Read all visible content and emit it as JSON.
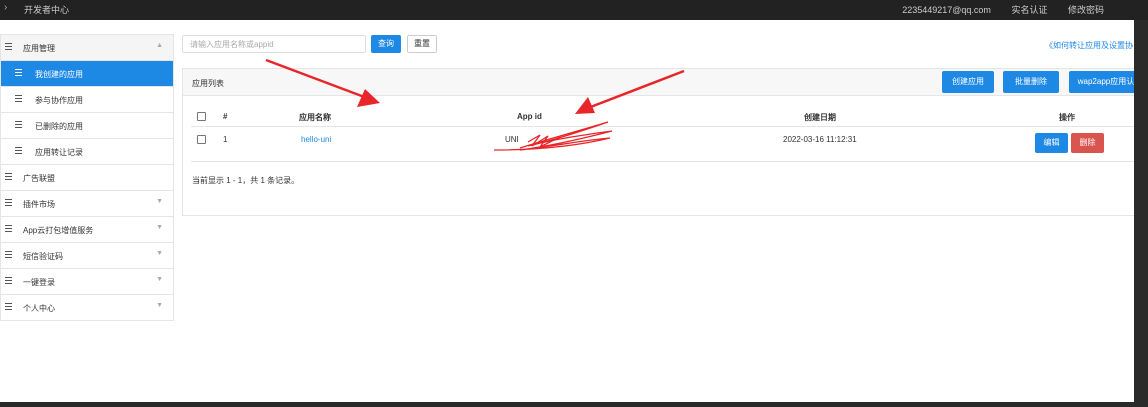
{
  "topbar": {
    "title": "开发者中心",
    "email": "2235449217@qq.com",
    "verify": "实名认证",
    "change_password": "修改密码"
  },
  "sidebar": {
    "items": [
      {
        "label": "应用管理",
        "type": "group-open"
      },
      {
        "label": "我创建的应用",
        "type": "sub-active"
      },
      {
        "label": "参与协作应用",
        "type": "sub"
      },
      {
        "label": "已删除的应用",
        "type": "sub"
      },
      {
        "label": "应用转让记录",
        "type": "sub"
      },
      {
        "label": "广告联盟",
        "type": "group"
      },
      {
        "label": "插件市场",
        "type": "group-caret"
      },
      {
        "label": "App云打包增值服务",
        "type": "group-caret"
      },
      {
        "label": "短信验证码",
        "type": "group-caret"
      },
      {
        "label": "一键登录",
        "type": "group-caret"
      },
      {
        "label": "个人中心",
        "type": "group-caret"
      }
    ]
  },
  "search": {
    "placeholder": "请输入应用名称或appid",
    "query_label": "查询",
    "reset_label": "重置"
  },
  "help_link": "《如何转让应用及设置协",
  "panel": {
    "title": "应用列表",
    "create_label": "创建应用",
    "batch_delete_label": "批量删除",
    "wap2app_label": "wap2app应用认"
  },
  "table": {
    "headers": {
      "index": "#",
      "name": "应用名称",
      "appid": "App id",
      "created": "创建日期",
      "ops": "操作"
    },
    "rows": [
      {
        "index": "1",
        "name": "hello-uni",
        "appid": "UNI",
        "created": "2022-03-16 11:12:31",
        "edit_label": "编辑",
        "delete_label": "删除"
      }
    ],
    "summary": "当前显示 1 - 1，共 1 条记录。"
  },
  "colors": {
    "primary": "#1e88e5",
    "danger": "#d9534f",
    "annotation": "#e8262a"
  }
}
